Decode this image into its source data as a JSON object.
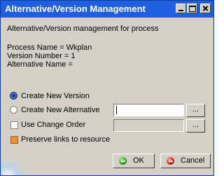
{
  "window": {
    "title": "Alternative/Version Management"
  },
  "info": {
    "heading": "Alternative/Version management for process",
    "process_name": "Process Name = Wkplan",
    "version_number": "Version Number = 1",
    "alternative_name": "Alternative Name ="
  },
  "options": {
    "create_new_version": {
      "label": "Create New Version",
      "selected": true
    },
    "create_new_alternative": {
      "label": "Create New Alternative",
      "selected": false,
      "field_value": "",
      "browse_label": "..."
    },
    "use_change_order": {
      "label": "Use Change Order",
      "checked": false,
      "field_value": "",
      "browse_label": "..."
    },
    "preserve_links": {
      "label": "Preserve links to resource",
      "checked": true
    }
  },
  "buttons": {
    "ok_label": "OK",
    "cancel_label": "Cancel"
  },
  "colors": {
    "titlebar": "#1f5ee0",
    "dialog_background": "#d4d0c8",
    "ok_icon": "#2fa21a",
    "cancel_icon": "#d8261b",
    "checkbox_checked": "#e59340"
  }
}
